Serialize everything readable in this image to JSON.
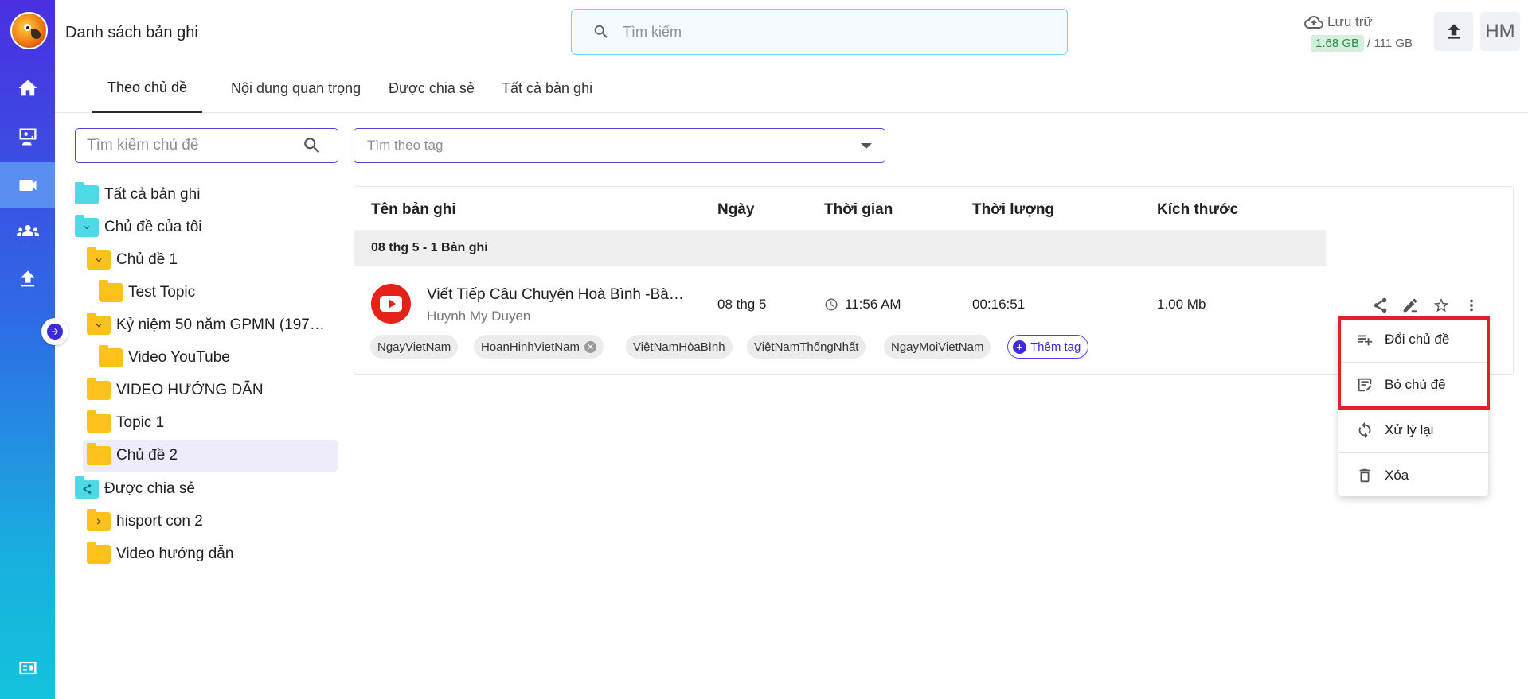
{
  "header": {
    "title": "Danh sách bản ghi",
    "search_placeholder": "Tìm kiếm",
    "storage_label": "Lưu trữ",
    "storage_used": "1.68 GB",
    "storage_total": "/ 111 GB",
    "avatar_initials": "HM"
  },
  "tabs": [
    {
      "label": "Theo chủ đề",
      "active": true
    },
    {
      "label": "Nội dung quan trọng"
    },
    {
      "label": "Được chia sẻ"
    },
    {
      "label": "Tất cả bản ghi"
    }
  ],
  "sidebar": {
    "search_placeholder": "Tìm kiếm chủ đề",
    "tree": [
      {
        "label": "Tất cả bản ghi",
        "color": "cyan",
        "icon": "folder-icon"
      },
      {
        "label": "Chủ đề của tôi",
        "color": "cyan",
        "icon": "chevron-down-icon"
      },
      {
        "label": "Chủ đề 1",
        "color": "yellow",
        "icon": "chevron-down-icon"
      },
      {
        "label": "Test Topic",
        "color": "yellow",
        "icon": "folder-icon"
      },
      {
        "label": "Kỷ niệm 50 năm GPMN (197…",
        "color": "yellow",
        "icon": "chevron-down-icon"
      },
      {
        "label": "Video YouTube",
        "color": "yellow",
        "icon": "folder-icon"
      },
      {
        "label": "VIDEO HƯỚNG DẪN",
        "color": "yellow",
        "icon": "folder-icon"
      },
      {
        "label": "Topic 1",
        "color": "yellow",
        "icon": "folder-icon"
      },
      {
        "label": "Chủ đề 2",
        "color": "yellow",
        "icon": "folder-icon",
        "selected": true
      },
      {
        "label": "Được chia sẻ",
        "color": "cyan",
        "icon": "share-icon"
      },
      {
        "label": "hisport con 2",
        "color": "yellow",
        "icon": "chevron-right-icon"
      },
      {
        "label": "Video hướng dẫn",
        "color": "yellow",
        "icon": "folder-icon"
      }
    ]
  },
  "tag_filter": {
    "placeholder": "Tìm theo tag"
  },
  "table": {
    "columns": [
      "Tên bản ghi",
      "Ngày",
      "Thời gian",
      "Thời lượng",
      "Kích thước"
    ],
    "group_label": "08 thg 5 - 1 Bản ghi",
    "record": {
      "title": "Viết Tiếp Câu Chuyện Hoà Bình -Bà…",
      "owner": "Huynh My Duyen",
      "date": "08 thg 5",
      "time": "11:56 AM",
      "duration": "00:16:51",
      "size": "1.00 Mb",
      "tags": [
        "NgayVietNam",
        "HoanHinhVietNam",
        "ViệtNamHòaBình",
        "ViệtNamThốngNhất",
        "NgayMoiVietNam"
      ],
      "add_tag_label": "Thêm tag"
    }
  },
  "context_menu": {
    "items": [
      "Đổi chủ đề",
      "Bỏ chủ đề",
      "Xử lý lại",
      "Xóa"
    ]
  },
  "colors": {
    "accent": "#3f2ad8",
    "highlight": "#e0202a",
    "folder_yellow": "#fcc21b",
    "folder_cyan": "#4dd9e6"
  }
}
